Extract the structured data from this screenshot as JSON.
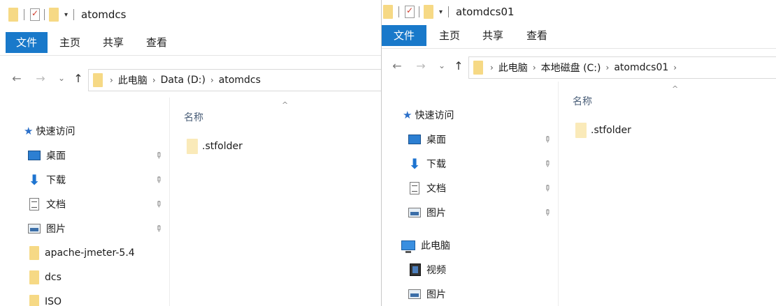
{
  "left_window": {
    "title": "atomdcs",
    "ribbon_tabs": [
      "文件",
      "主页",
      "共享",
      "查看"
    ],
    "breadcrumbs": [
      "此电脑",
      "Data (D:)",
      "atomdcs"
    ],
    "nav": {
      "quick_access": "快速访问",
      "desktop": "桌面",
      "downloads": "下载",
      "documents": "文档",
      "pictures": "图片",
      "folder1": "apache-jmeter-5.4",
      "folder2": "dcs",
      "folder3": "ISO"
    },
    "column_name": "名称",
    "files": [
      ".stfolder"
    ]
  },
  "right_window": {
    "title": "atomdcs01",
    "ribbon_tabs": [
      "文件",
      "主页",
      "共享",
      "查看"
    ],
    "breadcrumbs": [
      "此电脑",
      "本地磁盘 (C:)",
      "atomdcs01"
    ],
    "nav": {
      "quick_access": "快速访问",
      "desktop": "桌面",
      "downloads": "下载",
      "documents": "文档",
      "pictures": "图片",
      "this_pc": "此电脑",
      "videos": "视频",
      "pictures2": "图片"
    },
    "column_name": "名称",
    "files": [
      ".stfolder"
    ]
  },
  "icons": {
    "back": "←",
    "forward": "→",
    "recent": "⌄",
    "up": "↑",
    "chevron": "›",
    "sort": "^",
    "pin": "📌"
  },
  "colors": {
    "file_tab": "#1979ca",
    "folder": "#f4d47a",
    "column_header": "#4c607a"
  }
}
